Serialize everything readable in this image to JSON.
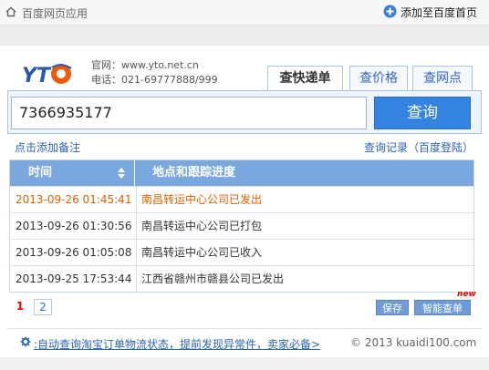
{
  "topbar": {
    "title": "百度网页应用",
    "add_link": "添加至百度首页"
  },
  "site": {
    "logo_text": "YTO",
    "website": "官网：www.yto.net.cn",
    "phone": "电话：021-69777888/999"
  },
  "tabs": [
    {
      "label": "查快递单",
      "active": true
    },
    {
      "label": "查价格",
      "active": false
    },
    {
      "label": "查网点",
      "active": false
    }
  ],
  "search": {
    "value": "7366935177",
    "button": "查询"
  },
  "links": {
    "add_note": "点击添加备注",
    "history": "查询记录（百度登陆）"
  },
  "table": {
    "headers": [
      "时间",
      "地点和跟踪进度"
    ],
    "rows": [
      {
        "time": "2013-09-26 01:45:41",
        "status": "南昌转运中心公司已发出"
      },
      {
        "time": "2013-09-26 01:30:56",
        "status": "南昌转运中心公司已打包"
      },
      {
        "time": "2013-09-26 01:05:08",
        "status": "南昌转运中心公司已收入"
      },
      {
        "time": "2013-09-25 17:53:44",
        "status": "江西省赣州市赣县公司已发出"
      }
    ]
  },
  "pagination": {
    "current": "1",
    "next": "2"
  },
  "actions": {
    "save": "保存",
    "smart": "智能查单",
    "new_badge": "new"
  },
  "footer": {
    "tip": ":自动查询淘宝订单物流状态，提前发现异常件，卖家必备>",
    "copyright": "© 2013 kuaidi100.com"
  },
  "colors": {
    "accent_blue": "#3583e0",
    "header_blue": "#7ba7df",
    "link_blue": "#2965b8",
    "highlight_orange": "#e06000"
  }
}
